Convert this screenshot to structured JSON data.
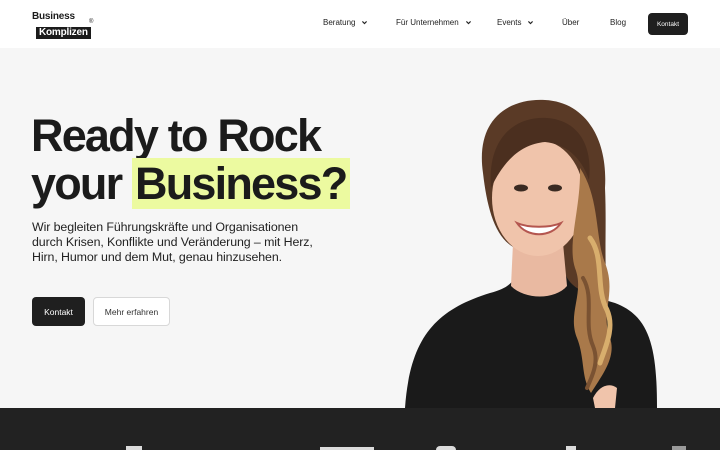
{
  "header": {
    "logo": {
      "line1": "Business",
      "line2": "Komplizen",
      "reg": "®"
    },
    "nav": [
      {
        "label": "Beratung",
        "dropdown": true
      },
      {
        "label": "Für Unternehmen",
        "dropdown": true
      },
      {
        "label": "Events",
        "dropdown": true
      },
      {
        "label": "Über",
        "dropdown": false
      },
      {
        "label": "Blog",
        "dropdown": false
      }
    ],
    "cta_label": "Kontakt"
  },
  "hero": {
    "headline_line1": "Ready to Rock",
    "headline_line2_a": "your",
    "headline_line2_highlight": "Business?",
    "subtext": "Wir begleiten Führungskräfte und Organisationen durch Krisen, Konflikte und Veränderung – mit Herz, Hirn, Humor und dem Mut, genau hinzusehen.",
    "primary_button": "Kontakt",
    "secondary_button": "Mehr erfahren",
    "highlight_color": "#ecfaa0"
  },
  "icons": {
    "dropdown": "chevron-down-icon"
  }
}
